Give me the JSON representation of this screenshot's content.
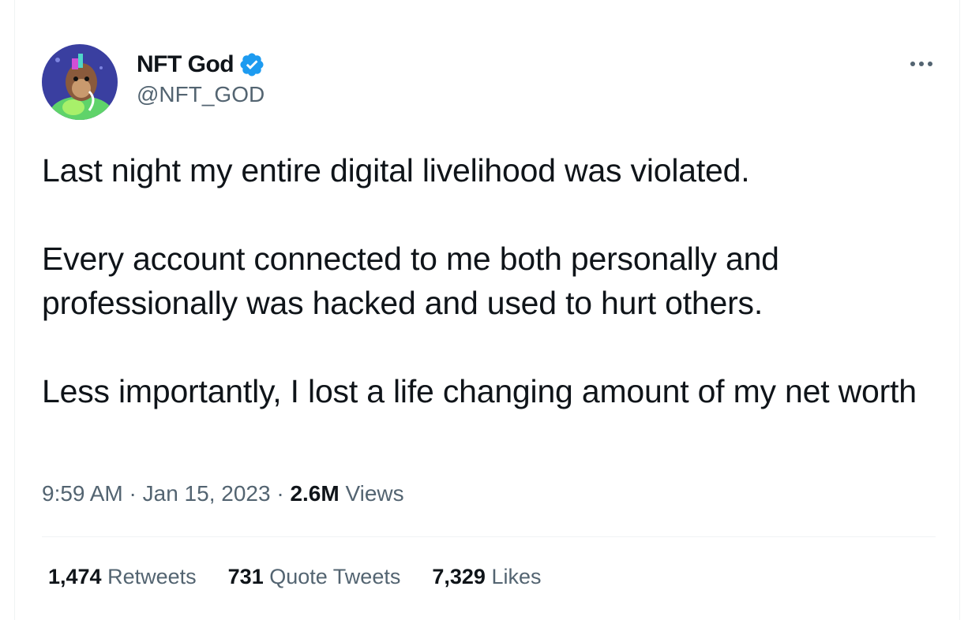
{
  "author": {
    "display_name": "NFT God",
    "handle": "@NFT_GOD",
    "verified_color": "#1d9bf0"
  },
  "tweet": {
    "paragraphs": [
      "Last night my entire digital livelihood was violated.",
      "Every account connected to me both personally and professionally was hacked and used to hurt others.",
      "Less importantly, I lost a life changing amount of my net worth"
    ],
    "time": "9:59 AM",
    "separator": "·",
    "date": "Jan 15, 2023",
    "views_count": "2.6M",
    "views_label": "Views"
  },
  "stats": {
    "retweets_count": "1,474",
    "retweets_label": "Retweets",
    "quotes_count": "731",
    "quotes_label": "Quote Tweets",
    "likes_count": "7,329",
    "likes_label": "Likes"
  },
  "icons": {
    "more": "more-options-icon",
    "verified": "verified-badge-icon"
  }
}
